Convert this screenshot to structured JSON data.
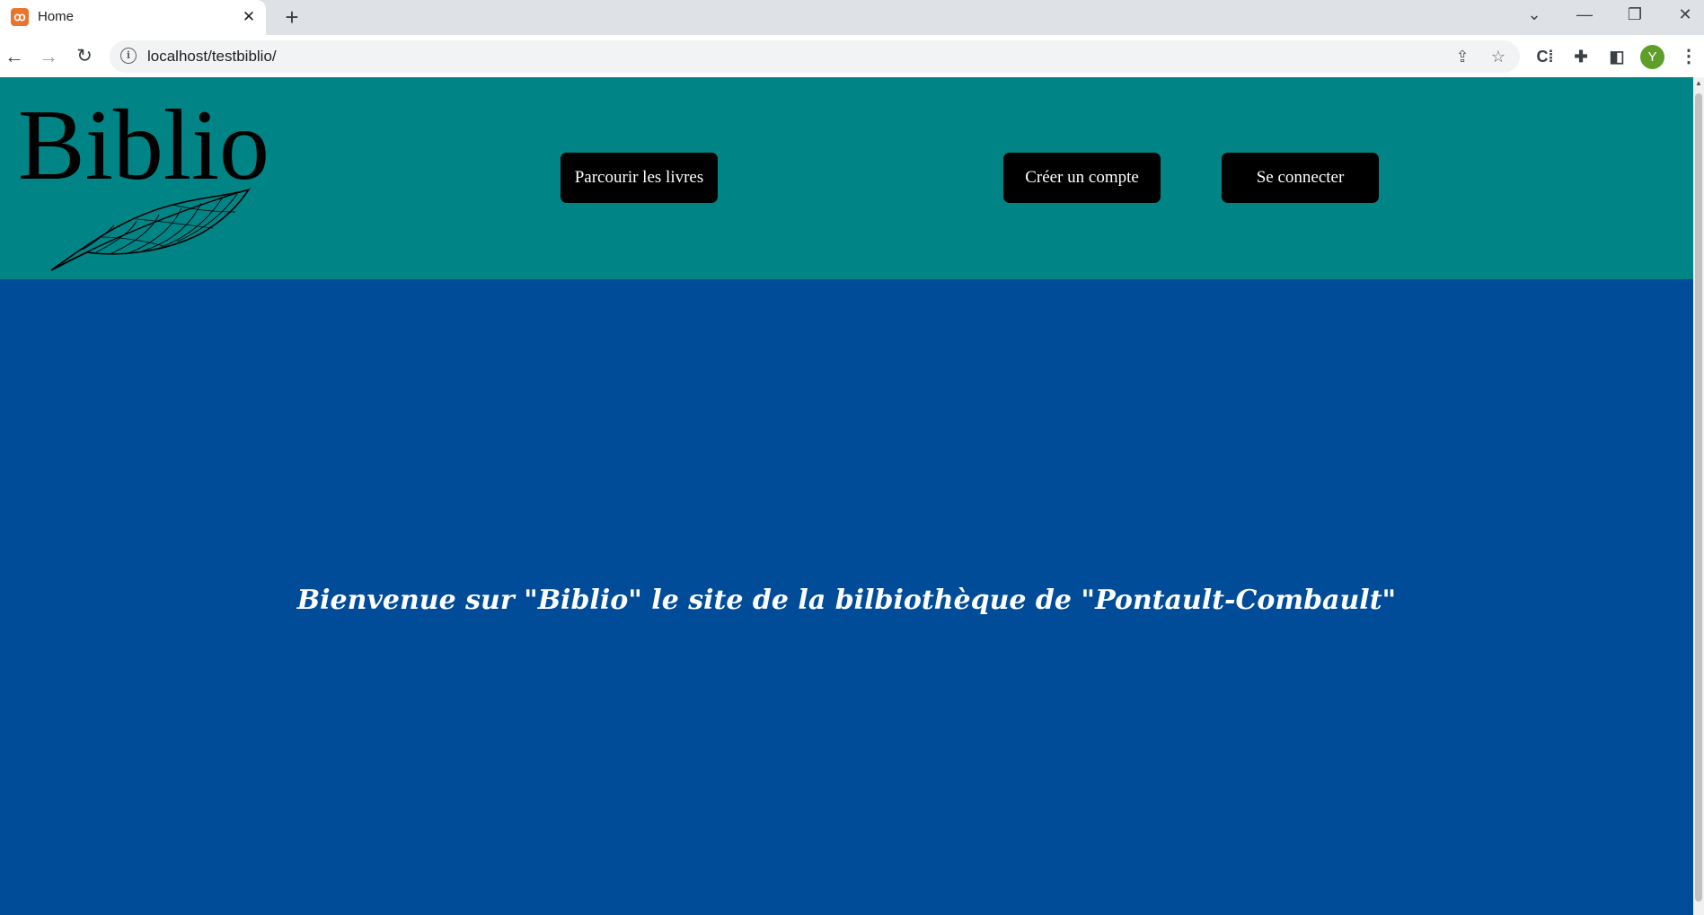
{
  "browser": {
    "tab_title": "Home",
    "favicon_glyph": "ꝏ",
    "url": "localhost/testbiblio/",
    "avatar_initial": "Y"
  },
  "page": {
    "logo_text": "Biblio",
    "nav": {
      "browse_label": "Parcourir les livres",
      "signup_label": "Créer un compte",
      "login_label": "Se connecter"
    },
    "welcome_text": "Bienvenue sur \"Biblio\" le site de la bilbiothèque de \"Pontault-Combault\""
  },
  "colors": {
    "header_bg": "#008486",
    "main_bg": "#004c99",
    "button_bg": "#000000",
    "button_text": "#ffffff",
    "welcome_text": "#ffffff"
  },
  "icons": {
    "back": "back-arrow-icon",
    "forward": "forward-arrow-icon",
    "reload": "reload-icon",
    "info": "info-icon",
    "share": "share-icon",
    "bookmark": "star-icon",
    "extensions": "puzzle-icon",
    "side_panel": "side-panel-icon",
    "menu": "kebab-menu-icon",
    "logo_feather": "feather-icon"
  }
}
